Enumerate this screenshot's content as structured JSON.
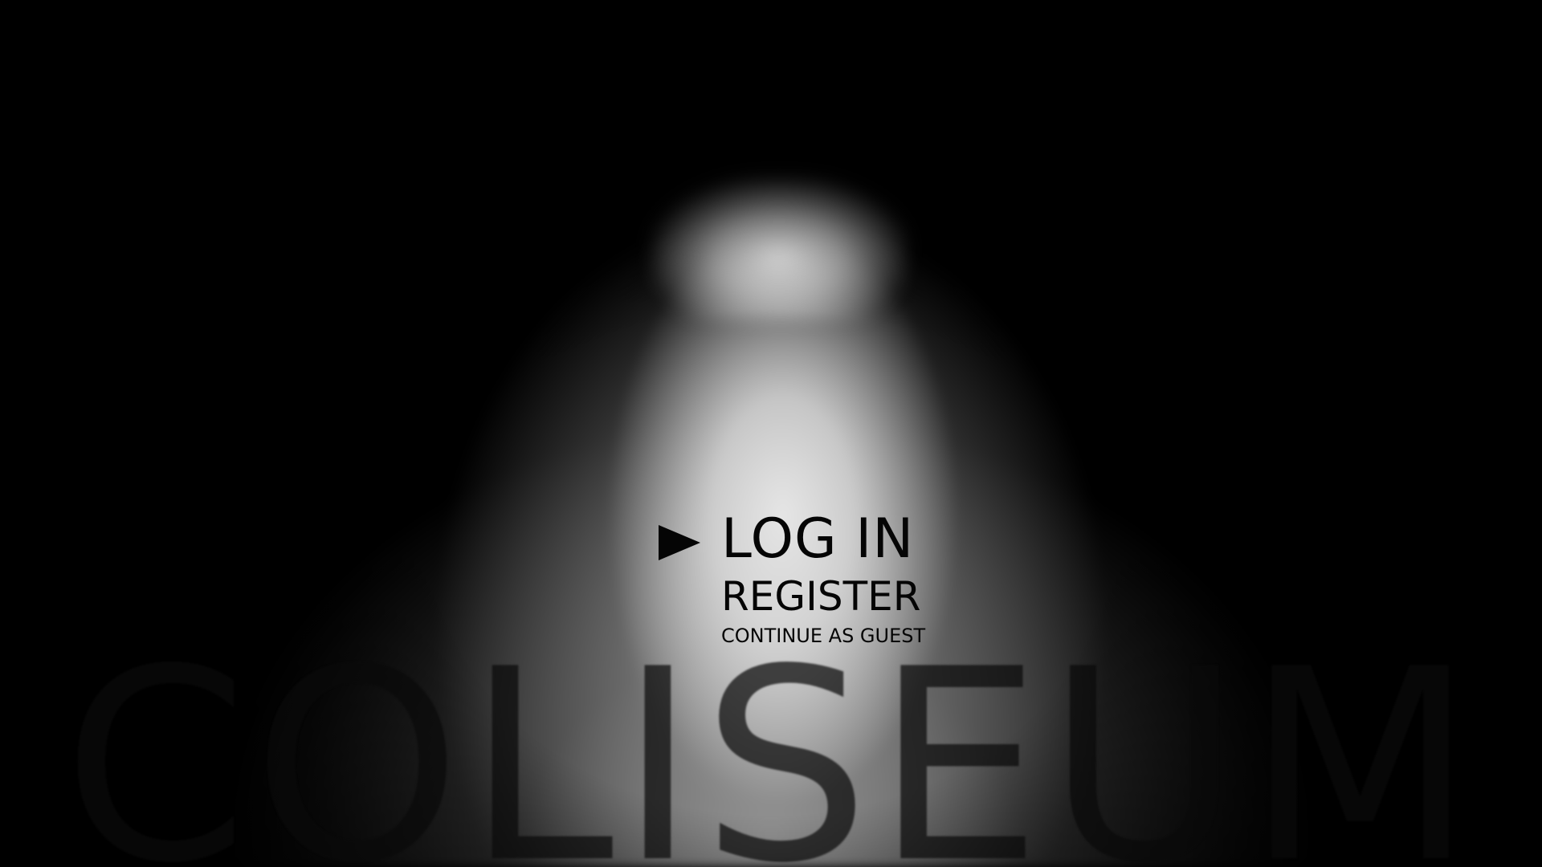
{
  "background": {
    "title_text": "COLISEUM"
  },
  "menu": {
    "selected_indicator_icon": "right-triangle-pointer",
    "items": [
      {
        "label": "LOG IN",
        "selected": true
      },
      {
        "label": "REGISTER",
        "selected": false
      },
      {
        "label": "CONTINUE AS GUEST",
        "selected": false
      }
    ]
  }
}
